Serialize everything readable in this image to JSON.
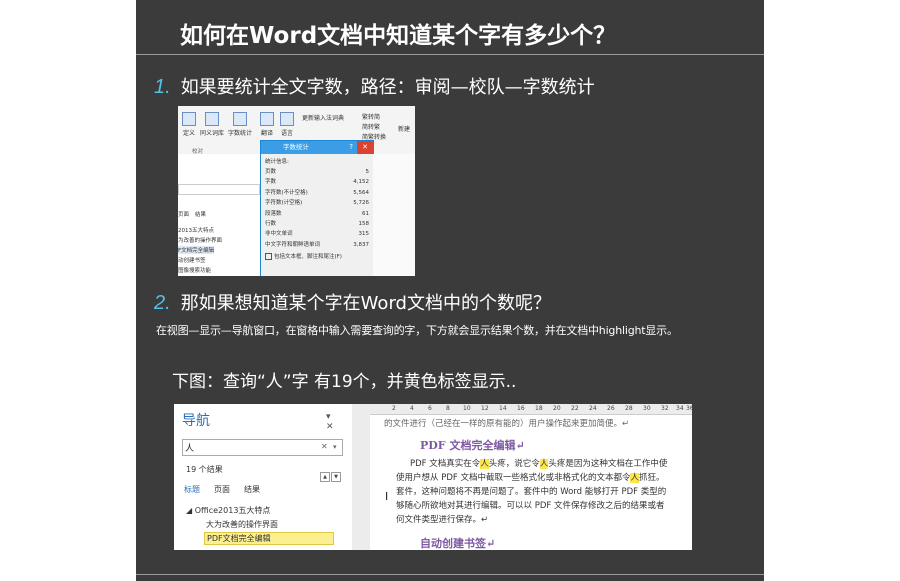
{
  "title": "如何在Word文档中知道某个字有多少个？",
  "step1": {
    "num": "1.",
    "text": "如果要统计全文字数，路径：审阅—校队—字数统计"
  },
  "step2": {
    "num": "2.",
    "text": "那如果想知道某个字在Word文档中的个数呢？"
  },
  "step2_desc": "在视图—显示—导航窗口，在窗格中输入需要查询的字，下方就会显示结果个数，并在文档中highlight显示。",
  "caption": "下图：查询“人”字 有19个，并黄色标签显示..",
  "shot1": {
    "ribbon_buttons": [
      "定义",
      "同义词库",
      "字数统计",
      "翻译",
      "语言",
      "更新输入法词典",
      "繁转简",
      "简转繁",
      "简繁转换",
      "新建"
    ],
    "ribbon_group": "校对",
    "dialog_title": "字数统计",
    "dialog_help": "?",
    "dialog_close": "✕",
    "stats_header": "统计信息:",
    "stats": [
      {
        "label": "页数",
        "value": "5"
      },
      {
        "label": "字数",
        "value": "4,152"
      },
      {
        "label": "字符数(不计空格)",
        "value": "5,564"
      },
      {
        "label": "字符数(计空格)",
        "value": "5,726"
      },
      {
        "label": "段落数",
        "value": "61"
      },
      {
        "label": "行数",
        "value": "158"
      },
      {
        "label": "非中文单词",
        "value": "315"
      },
      {
        "label": "中文字符和朝鲜语单词",
        "value": "3,837"
      }
    ],
    "checkbox_label": "包括文本框、脚注和尾注(F)",
    "sidebar_tabs": [
      "页面",
      "结果"
    ],
    "sidebar_items": [
      "2013五大特点",
      "为改善的操作界面",
      "F文档完全编辑",
      "动创建书签",
      "图像搜索功能"
    ]
  },
  "shot2": {
    "nav_title": "导航",
    "nav_controls": "▾ ✕",
    "search_value": "人",
    "search_clear": "✕",
    "search_dropdown": "▾",
    "result_count": "19 个结果",
    "tabs": [
      "标题",
      "页面",
      "结果"
    ],
    "tree": [
      {
        "text": "◢ Office2013五大特点",
        "indent": 0
      },
      {
        "text": "大为改善的操作界面",
        "indent": 1
      },
      {
        "text": "PDF文档完全编辑",
        "indent": 1,
        "selected": true
      }
    ],
    "ruler_ticks": [
      "2",
      "4",
      "6",
      "8",
      "10",
      "12",
      "14",
      "16",
      "18",
      "20",
      "22",
      "24",
      "26",
      "28",
      "30",
      "32",
      "34",
      "36"
    ],
    "doc_top_line": "的文件进行（己经在一样的原有能的）用户操作起来更加简便。↵",
    "heading1": "PDF 文档完全编辑↵",
    "para1_a": "PDF 文档真实在令",
    "para1_b": "人",
    "para1_c": "头疼，说它令",
    "para1_d": "人",
    "para1_e": "头疼是因为这种文档在工作中使",
    "para2_a": "使用户想从 PDF 文档中截取一些格式化或非格式化的文本都令",
    "para2_b": "人",
    "para2_c": "抓狂。",
    "para3": "套件，这种问题将不再是问题了。套件中的 Word 能够打开 PDF 类型的",
    "para4": "够随心所欲地对其进行编辑。可以以 PDF 文件保存修改之后的结果或者",
    "para5": "何文件类型进行保存。↵",
    "heading2": "自动创建书签↵"
  }
}
